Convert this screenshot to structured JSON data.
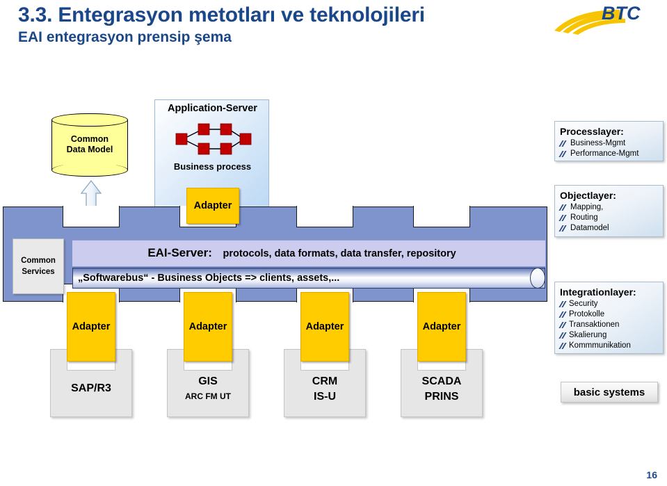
{
  "slide": {
    "title_main": "3.3. Entegrasyon metotları ve teknolojileri",
    "title_sub": "EAI entegrasyon prensip şema",
    "page_number": "16",
    "logo_text": "BTC",
    "title_color": "#1a4789"
  },
  "diagram": {
    "common_data_model": {
      "line1": "Common",
      "line2": "Data Model",
      "fill_color": "#ffff99"
    },
    "application_server": {
      "title": "Application-Server",
      "caption": "Business process",
      "node_color": "#cc0000"
    },
    "adapter_top_label": "Adapter",
    "common_services": {
      "line1": "Common",
      "line2": "Services"
    },
    "eai_server": {
      "label": "EAI-Server:",
      "detail": "protocols, data formats, data transfer, repository"
    },
    "softwarebus": {
      "text": "„Softwarebus“ - Business Objects => clients, assets,..."
    },
    "panel_color": "#7f94cc",
    "band_color": "#ccccee",
    "adapter_color": "#ffcc00",
    "adapters": [
      {
        "label": "Adapter"
      },
      {
        "label": "Adapter"
      },
      {
        "label": "Adapter"
      },
      {
        "label": "Adapter"
      }
    ],
    "base_systems": [
      {
        "line1": "SAP/R3",
        "line2": ""
      },
      {
        "line1": "GIS",
        "line2": "ARC FM UT"
      },
      {
        "line1": "CRM",
        "line2": "IS-U"
      },
      {
        "line1": "SCADA",
        "line2": "PRINS"
      }
    ],
    "basic_systems_label": "basic systems"
  },
  "layers": [
    {
      "title": "Processlayer:",
      "items": [
        "Business-Mgmt",
        "Performance-Mgmt"
      ]
    },
    {
      "title": "Objectlayer:",
      "items": [
        "Mapping,",
        "Routing",
        "Datamodel"
      ]
    },
    {
      "title": "Integrationlayer:",
      "items": [
        "Security",
        "Protokolle",
        "Transaktionen",
        "Skalierung",
        "Kommmunikation"
      ]
    }
  ]
}
